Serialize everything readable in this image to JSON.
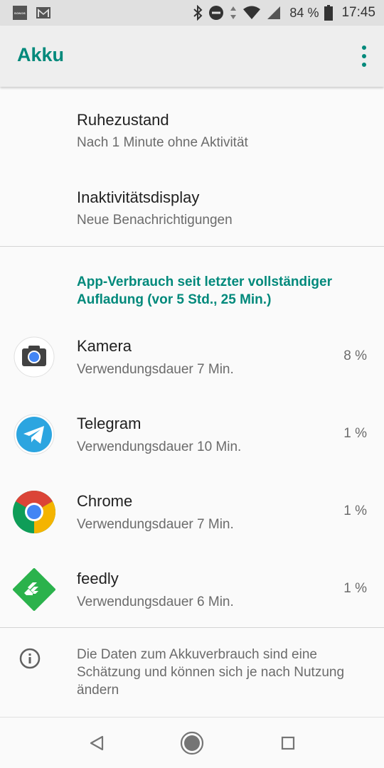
{
  "status_bar": {
    "sonos_label": "SONOS",
    "battery_percent": "84 %",
    "time": "17:45",
    "icons": [
      "sonos-icon",
      "gmail-icon",
      "bluetooth-icon",
      "do-not-disturb-icon",
      "data-arrows-icon",
      "wifi-icon",
      "signal-icon",
      "battery-icon"
    ]
  },
  "app_bar": {
    "title": "Akku",
    "menu_icon": "overflow-menu-icon"
  },
  "preferences": [
    {
      "title": "Ruhezustand",
      "summary": "Nach 1 Minute ohne Aktivität"
    },
    {
      "title": "Inaktivitätsdisplay",
      "summary": "Neue Benachrichtigungen"
    }
  ],
  "section_header": "App-Verbrauch seit letzter vollständiger Aufladung (vor 5 Std., 25 Min.)",
  "apps": [
    {
      "name": "Kamera",
      "usage": "Verwendungsdauer 7 Min.",
      "percent": "8 %",
      "icon": "camera-icon"
    },
    {
      "name": "Telegram",
      "usage": "Verwendungsdauer 10 Min.",
      "percent": "1 %",
      "icon": "telegram-icon"
    },
    {
      "name": "Chrome",
      "usage": "Verwendungsdauer 7 Min.",
      "percent": "1 %",
      "icon": "chrome-icon"
    },
    {
      "name": "feedly",
      "usage": "Verwendungsdauer 6 Min.",
      "percent": "1 %",
      "icon": "feedly-icon"
    }
  ],
  "footer": {
    "text": "Die Daten zum Akkuverbrauch sind eine Schätzung und können sich je nach Nutzung ändern",
    "icon": "info-icon"
  },
  "nav_bar": {
    "buttons": [
      "back-icon",
      "home-icon",
      "recents-icon"
    ]
  },
  "colors": {
    "accent": "#00897b",
    "chrome_red": "#db4437",
    "chrome_green": "#0f9d58",
    "chrome_yellow": "#f4b400",
    "chrome_blue": "#4285f4",
    "telegram_blue": "#2ca5e0",
    "feedly_green": "#2bb24c"
  }
}
